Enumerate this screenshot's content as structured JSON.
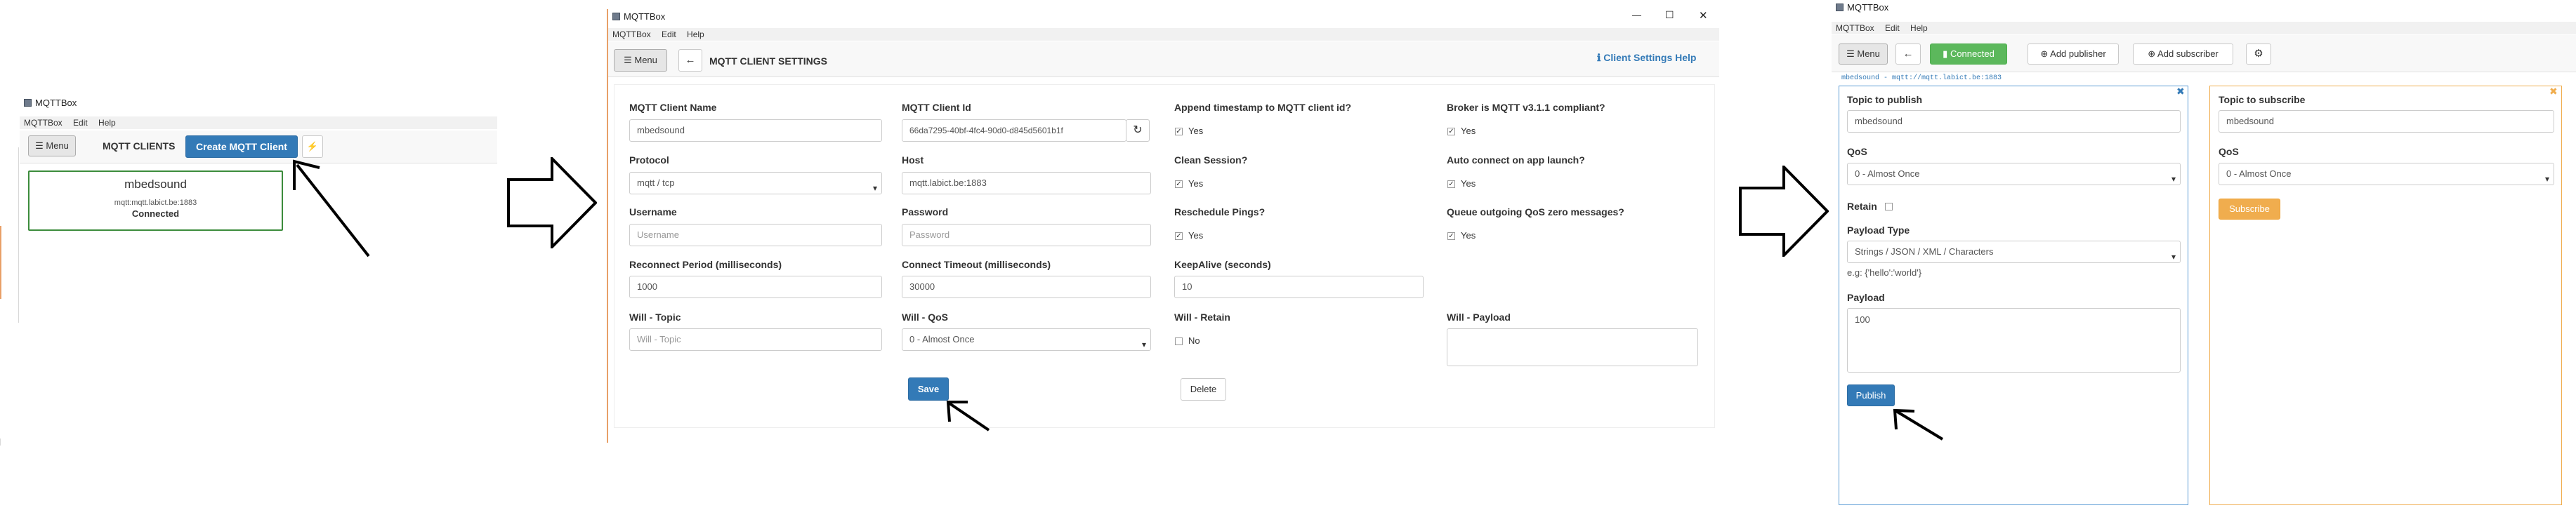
{
  "app_title": "MQTTBox",
  "menus": [
    "MQTTBox",
    "Edit",
    "Help"
  ],
  "panel1": {
    "menu_button": "☰ Menu",
    "section_title": "MQTT CLIENTS",
    "create_button": "Create MQTT Client",
    "lightning_icon": "⚡",
    "client_card": {
      "name": "mbedsound",
      "host": "mqtt:mqtt.labict.be:1883",
      "status": "Connected"
    }
  },
  "panel2": {
    "menu_button": "☰ Menu",
    "back_icon": "←",
    "page_title": "MQTT CLIENT SETTINGS",
    "help_link": "Client Settings Help",
    "help_icon": "ℹ",
    "fields": {
      "client_name_label": "MQTT Client Name",
      "client_name_value": "mbedsound",
      "client_id_label": "MQTT Client Id",
      "client_id_value": "66da7295-40bf-4fc4-90d0-d845d5601b1f",
      "append_ts_label": "Append timestamp to MQTT client id?",
      "append_ts_value": "Yes",
      "broker_compliant_label": "Broker is MQTT v3.1.1 compliant?",
      "broker_compliant_value": "Yes",
      "protocol_label": "Protocol",
      "protocol_value": "mqtt / tcp",
      "host_label": "Host",
      "host_value": "mqtt.labict.be:1883",
      "clean_session_label": "Clean Session?",
      "clean_session_value": "Yes",
      "auto_connect_label": "Auto connect on app launch?",
      "auto_connect_value": "Yes",
      "username_label": "Username",
      "username_placeholder": "Username",
      "password_label": "Password",
      "password_placeholder": "Password",
      "reschedule_label": "Reschedule Pings?",
      "reschedule_value": "Yes",
      "queue_label": "Queue outgoing QoS zero messages?",
      "queue_value": "Yes",
      "reconnect_label": "Reconnect Period (milliseconds)",
      "reconnect_value": "1000",
      "timeout_label": "Connect Timeout (milliseconds)",
      "timeout_value": "30000",
      "keepalive_label": "KeepAlive (seconds)",
      "keepalive_value": "10",
      "will_topic_label": "Will - Topic",
      "will_topic_placeholder": "Will - Topic",
      "will_qos_label": "Will - QoS",
      "will_qos_value": "0 - Almost Once",
      "will_retain_label": "Will - Retain",
      "will_retain_value": "No",
      "will_payload_label": "Will - Payload"
    },
    "save_button": "Save",
    "delete_button": "Delete"
  },
  "panel3": {
    "menu_button": "☰ Menu",
    "back_icon": "←",
    "connected_button": "Connected",
    "add_publisher": "Add publisher",
    "add_subscriber": "Add subscriber",
    "gear_icon": "⚙",
    "connection_info": "mbedsound - mqtt://mqtt.labict.be:1883",
    "publisher": {
      "topic_label": "Topic to publish",
      "topic_value": "mbedsound",
      "qos_label": "QoS",
      "qos_value": "0 - Almost Once",
      "retain_label": "Retain",
      "payload_type_label": "Payload Type",
      "payload_type_value": "Strings / JSON / XML / Characters",
      "payload_hint": "e.g: {'hello':'world'}",
      "payload_label": "Payload",
      "payload_value": "100",
      "publish_button": "Publish",
      "close_icon": "✖"
    },
    "subscriber": {
      "topic_label": "Topic to subscribe",
      "topic_value": "mbedsound",
      "qos_label": "QoS",
      "qos_value": "0 - Almost Once",
      "subscribe_button": "Subscribe",
      "close_icon": "✖"
    }
  },
  "window_controls": {
    "minimize": "—",
    "maximize": "☐",
    "close": "✕"
  },
  "colors": {
    "primary": "#337ab7",
    "success": "#5cb85c",
    "warning": "#f0ad4e",
    "card_border_green": "#3c8c3c",
    "orange_line": "#e8a068"
  }
}
